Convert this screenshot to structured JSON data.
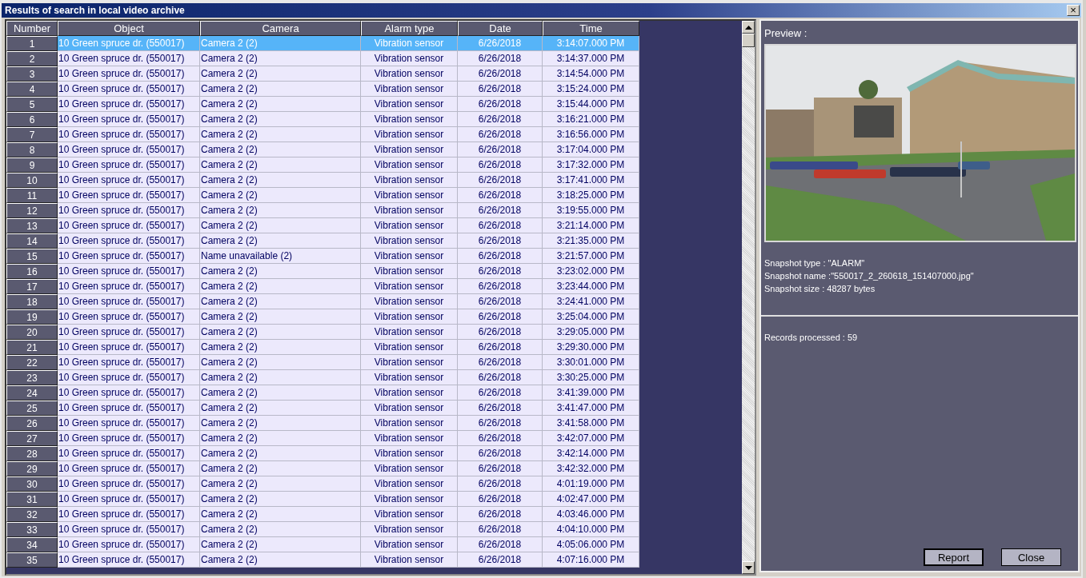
{
  "window": {
    "title": "Results of search in local video archive",
    "close": "×"
  },
  "table": {
    "columns": [
      "Number",
      "Object",
      "Camera",
      "Alarm type",
      "Date",
      "Time"
    ],
    "rows": [
      {
        "cells": [
          "1",
          "10 Green spruce dr. (550017)",
          "Camera 2 (2)",
          "Vibration sensor",
          "6/26/2018",
          "3:14:07.000 PM"
        ],
        "selected": true
      },
      {
        "cells": [
          "2",
          "10 Green spruce dr. (550017)",
          "Camera 2 (2)",
          "Vibration sensor",
          "6/26/2018",
          "3:14:37.000 PM"
        ],
        "selected": false
      },
      {
        "cells": [
          "3",
          "10 Green spruce dr. (550017)",
          "Camera 2 (2)",
          "Vibration sensor",
          "6/26/2018",
          "3:14:54.000 PM"
        ],
        "selected": false
      },
      {
        "cells": [
          "4",
          "10 Green spruce dr. (550017)",
          "Camera 2 (2)",
          "Vibration sensor",
          "6/26/2018",
          "3:15:24.000 PM"
        ],
        "selected": false
      },
      {
        "cells": [
          "5",
          "10 Green spruce dr. (550017)",
          "Camera 2 (2)",
          "Vibration sensor",
          "6/26/2018",
          "3:15:44.000 PM"
        ],
        "selected": false
      },
      {
        "cells": [
          "6",
          "10 Green spruce dr. (550017)",
          "Camera 2 (2)",
          "Vibration sensor",
          "6/26/2018",
          "3:16:21.000 PM"
        ],
        "selected": false
      },
      {
        "cells": [
          "7",
          "10 Green spruce dr. (550017)",
          "Camera 2 (2)",
          "Vibration sensor",
          "6/26/2018",
          "3:16:56.000 PM"
        ],
        "selected": false
      },
      {
        "cells": [
          "8",
          "10 Green spruce dr. (550017)",
          "Camera 2 (2)",
          "Vibration sensor",
          "6/26/2018",
          "3:17:04.000 PM"
        ],
        "selected": false
      },
      {
        "cells": [
          "9",
          "10 Green spruce dr. (550017)",
          "Camera 2 (2)",
          "Vibration sensor",
          "6/26/2018",
          "3:17:32.000 PM"
        ],
        "selected": false
      },
      {
        "cells": [
          "10",
          "10 Green spruce dr. (550017)",
          "Camera 2 (2)",
          "Vibration sensor",
          "6/26/2018",
          "3:17:41.000 PM"
        ],
        "selected": false
      },
      {
        "cells": [
          "11",
          "10 Green spruce dr. (550017)",
          "Camera 2 (2)",
          "Vibration sensor",
          "6/26/2018",
          "3:18:25.000 PM"
        ],
        "selected": false
      },
      {
        "cells": [
          "12",
          "10 Green spruce dr. (550017)",
          "Camera 2 (2)",
          "Vibration sensor",
          "6/26/2018",
          "3:19:55.000 PM"
        ],
        "selected": false
      },
      {
        "cells": [
          "13",
          "10 Green spruce dr. (550017)",
          "Camera 2 (2)",
          "Vibration sensor",
          "6/26/2018",
          "3:21:14.000 PM"
        ],
        "selected": false
      },
      {
        "cells": [
          "14",
          "10 Green spruce dr. (550017)",
          "Camera 2 (2)",
          "Vibration sensor",
          "6/26/2018",
          "3:21:35.000 PM"
        ],
        "selected": false
      },
      {
        "cells": [
          "15",
          "10 Green spruce dr. (550017)",
          "Name unavailable (2)",
          "Vibration sensor",
          "6/26/2018",
          "3:21:57.000 PM"
        ],
        "selected": false
      },
      {
        "cells": [
          "16",
          "10 Green spruce dr. (550017)",
          "Camera 2 (2)",
          "Vibration sensor",
          "6/26/2018",
          "3:23:02.000 PM"
        ],
        "selected": false
      },
      {
        "cells": [
          "17",
          "10 Green spruce dr. (550017)",
          "Camera 2 (2)",
          "Vibration sensor",
          "6/26/2018",
          "3:23:44.000 PM"
        ],
        "selected": false
      },
      {
        "cells": [
          "18",
          "10 Green spruce dr. (550017)",
          "Camera 2 (2)",
          "Vibration sensor",
          "6/26/2018",
          "3:24:41.000 PM"
        ],
        "selected": false
      },
      {
        "cells": [
          "19",
          "10 Green spruce dr. (550017)",
          "Camera 2 (2)",
          "Vibration sensor",
          "6/26/2018",
          "3:25:04.000 PM"
        ],
        "selected": false
      },
      {
        "cells": [
          "20",
          "10 Green spruce dr. (550017)",
          "Camera 2 (2)",
          "Vibration sensor",
          "6/26/2018",
          "3:29:05.000 PM"
        ],
        "selected": false
      },
      {
        "cells": [
          "21",
          "10 Green spruce dr. (550017)",
          "Camera 2 (2)",
          "Vibration sensor",
          "6/26/2018",
          "3:29:30.000 PM"
        ],
        "selected": false
      },
      {
        "cells": [
          "22",
          "10 Green spruce dr. (550017)",
          "Camera 2 (2)",
          "Vibration sensor",
          "6/26/2018",
          "3:30:01.000 PM"
        ],
        "selected": false
      },
      {
        "cells": [
          "23",
          "10 Green spruce dr. (550017)",
          "Camera 2 (2)",
          "Vibration sensor",
          "6/26/2018",
          "3:30:25.000 PM"
        ],
        "selected": false
      },
      {
        "cells": [
          "24",
          "10 Green spruce dr. (550017)",
          "Camera 2 (2)",
          "Vibration sensor",
          "6/26/2018",
          "3:41:39.000 PM"
        ],
        "selected": false
      },
      {
        "cells": [
          "25",
          "10 Green spruce dr. (550017)",
          "Camera 2 (2)",
          "Vibration sensor",
          "6/26/2018",
          "3:41:47.000 PM"
        ],
        "selected": false
      },
      {
        "cells": [
          "26",
          "10 Green spruce dr. (550017)",
          "Camera 2 (2)",
          "Vibration sensor",
          "6/26/2018",
          "3:41:58.000 PM"
        ],
        "selected": false
      },
      {
        "cells": [
          "27",
          "10 Green spruce dr. (550017)",
          "Camera 2 (2)",
          "Vibration sensor",
          "6/26/2018",
          "3:42:07.000 PM"
        ],
        "selected": false
      },
      {
        "cells": [
          "28",
          "10 Green spruce dr. (550017)",
          "Camera 2 (2)",
          "Vibration sensor",
          "6/26/2018",
          "3:42:14.000 PM"
        ],
        "selected": false
      },
      {
        "cells": [
          "29",
          "10 Green spruce dr. (550017)",
          "Camera 2 (2)",
          "Vibration sensor",
          "6/26/2018",
          "3:42:32.000 PM"
        ],
        "selected": false
      },
      {
        "cells": [
          "30",
          "10 Green spruce dr. (550017)",
          "Camera 2 (2)",
          "Vibration sensor",
          "6/26/2018",
          "4:01:19.000 PM"
        ],
        "selected": false
      },
      {
        "cells": [
          "31",
          "10 Green spruce dr. (550017)",
          "Camera 2 (2)",
          "Vibration sensor",
          "6/26/2018",
          "4:02:47.000 PM"
        ],
        "selected": false
      },
      {
        "cells": [
          "32",
          "10 Green spruce dr. (550017)",
          "Camera 2 (2)",
          "Vibration sensor",
          "6/26/2018",
          "4:03:46.000 PM"
        ],
        "selected": false
      },
      {
        "cells": [
          "33",
          "10 Green spruce dr. (550017)",
          "Camera 2 (2)",
          "Vibration sensor",
          "6/26/2018",
          "4:04:10.000 PM"
        ],
        "selected": false
      },
      {
        "cells": [
          "34",
          "10 Green spruce dr. (550017)",
          "Camera 2 (2)",
          "Vibration sensor",
          "6/26/2018",
          "4:05:06.000 PM"
        ],
        "selected": false
      },
      {
        "cells": [
          "35",
          "10 Green spruce dr. (550017)",
          "Camera 2 (2)",
          "Vibration sensor",
          "6/26/2018",
          "4:07:16.000 PM"
        ],
        "selected": false
      }
    ]
  },
  "preview": {
    "label": "Preview :",
    "info": [
      "Snapshot type : \"ALARM\"",
      "Snapshot name :\"550017_2_260618_151407000.jpg\"",
      "Snapshot size : 48287 bytes"
    ]
  },
  "status": {
    "records": "Records processed : 59"
  },
  "buttons": [
    {
      "label": "Report",
      "default": true
    },
    {
      "label": "Close",
      "default": false
    }
  ]
}
